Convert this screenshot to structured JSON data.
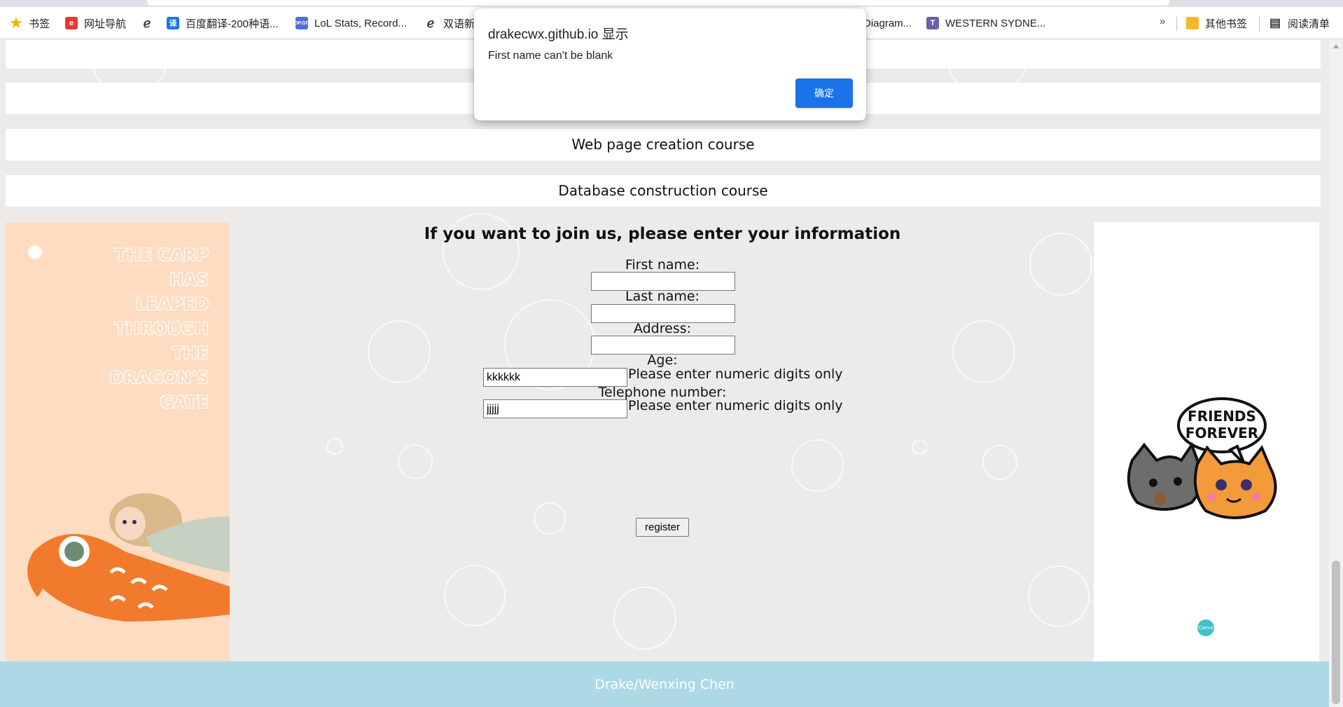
{
  "bookmarks_bar": {
    "items": [
      {
        "label": "书签",
        "icon": "star-icon"
      },
      {
        "label": "网址导航",
        "icon": "red-square-icon"
      },
      {
        "label": "",
        "icon": "ie-e-icon"
      },
      {
        "label": "百度翻译-200种语...",
        "icon": "translate-icon"
      },
      {
        "label": "LoL Stats, Record...",
        "icon": "opgg-icon"
      },
      {
        "label": "双语新",
        "icon": "ie-e-icon"
      },
      {
        "label": "Diagram...",
        "icon": ""
      },
      {
        "label": "WESTERN SYDNE...",
        "icon": "t-icon"
      }
    ],
    "overflow": "»",
    "other_bookmarks": "其他书签",
    "reading_list": "阅读清单"
  },
  "page": {
    "courses": [
      "Web page creation course",
      "Database construction course"
    ],
    "left_poster": {
      "lines": [
        "THE CARP",
        "HAS",
        "LEAPED",
        "THROUGH",
        "THE",
        "DRAGON'S",
        "GATE"
      ]
    },
    "right_poster": {
      "bubble_text": "FRIENDS FOREVER",
      "badge": "Canva"
    },
    "form": {
      "title": "If you want to join us, please enter your information",
      "first_name_label": "First name:",
      "first_name_value": "",
      "last_name_label": "Last name:",
      "last_name_value": "",
      "address_label": "Address:",
      "address_value": "",
      "age_label": "Age:",
      "age_value": "kkkkkk",
      "age_hint": "Please enter numeric digits only",
      "phone_label": "Telephone number:",
      "phone_value": "jjjjj",
      "phone_hint": "Please enter numeric digits only",
      "register_label": "register"
    },
    "footer": "Drake/Wenxing Chen"
  },
  "alert": {
    "title": "drakecwx.github.io 显示",
    "message": "First name can't be blank",
    "ok_label": "确定"
  },
  "colors": {
    "footer_bg": "#add8e6",
    "poster_bg": "#fddcc2",
    "dialog_button": "#1a73e8",
    "page_bg": "#ecebea"
  }
}
